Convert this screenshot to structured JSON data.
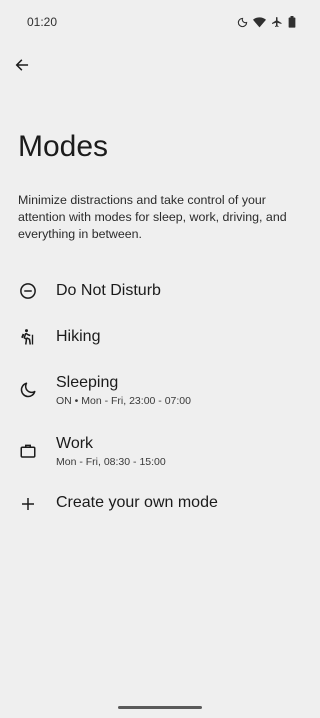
{
  "status_bar": {
    "time": "01:20",
    "icons": [
      "do-not-disturb-moon-icon",
      "wifi-icon",
      "airplane-icon",
      "battery-icon"
    ]
  },
  "header": {
    "back_icon": "arrow-left-icon"
  },
  "page": {
    "title": "Modes",
    "description": "Minimize distractions and take control of your attention with modes for sleep, work, driving, and everything in between."
  },
  "modes": [
    {
      "label": "Do Not Disturb",
      "subtitle": "",
      "icon": "minus-circle-icon"
    },
    {
      "label": "Hiking",
      "subtitle": "",
      "icon": "hiking-icon"
    },
    {
      "label": "Sleeping",
      "subtitle": "ON • Mon - Fri, 23:00 - 07:00",
      "icon": "moon-icon"
    },
    {
      "label": "Work",
      "subtitle": "Mon - Fri, 08:30 - 15:00",
      "icon": "briefcase-icon"
    },
    {
      "label": "Create your own mode",
      "subtitle": "",
      "icon": "plus-icon"
    }
  ]
}
